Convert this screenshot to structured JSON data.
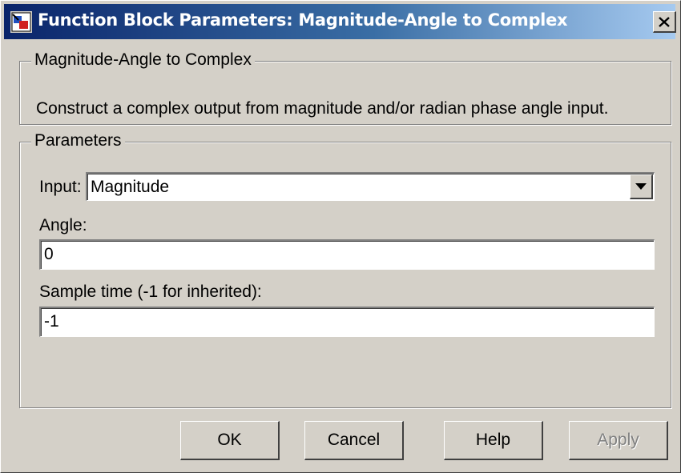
{
  "window": {
    "title": "Function Block Parameters: Magnitude-Angle to Complex"
  },
  "block_group": {
    "legend": "Magnitude-Angle to Complex",
    "description": "Construct a complex output from magnitude and/or radian phase angle input."
  },
  "params_group": {
    "legend": "Parameters",
    "input_label": "Input:",
    "input_value": "Magnitude",
    "angle_label": "Angle:",
    "angle_value": "0",
    "sample_label": "Sample time (-1 for inherited):",
    "sample_value": "-1"
  },
  "buttons": {
    "ok": "OK",
    "cancel": "Cancel",
    "help": "Help",
    "apply": "Apply"
  },
  "icons": {
    "app": "simulink-block-icon",
    "close": "close-icon",
    "dropdown": "chevron-down-icon"
  }
}
